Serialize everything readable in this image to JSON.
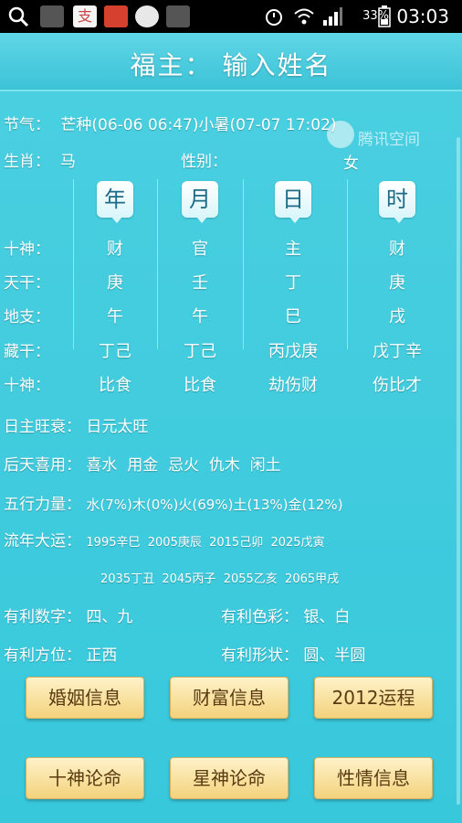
{
  "statusbar": {
    "battery_text": "33%",
    "time": "03:03",
    "icons": [
      "search-icon",
      "mail-app-icon",
      "alipay-icon",
      "app-icon",
      "weibo-icon",
      "mail-app-icon",
      "alarm-icon",
      "wifi-icon",
      "signal-icon",
      "battery-icon"
    ]
  },
  "title": "福主： 输入姓名",
  "watermark": "腾讯空间",
  "info": {
    "jieqi_label": "节气：",
    "jieqi_value": "芒种(06-06 06:47)小暑(07-07 17:02)",
    "shengxiao_label": "生肖：",
    "shengxiao_value": "马",
    "xingbie_label": "性别：",
    "xingbie_value": "女"
  },
  "columns": [
    "年",
    "月",
    "日",
    "时"
  ],
  "rows": [
    {
      "label": "十神：",
      "values": [
        "财",
        "官",
        "主",
        "财"
      ]
    },
    {
      "label": "天干：",
      "values": [
        "庚",
        "壬",
        "丁",
        "庚"
      ]
    },
    {
      "label": "地支：",
      "values": [
        "午",
        "午",
        "巳",
        "戌"
      ]
    },
    {
      "label": "藏干：",
      "values": [
        "丁己",
        "丁己",
        "丙戊庚",
        "戊丁辛"
      ]
    },
    {
      "label": "十神：",
      "values": [
        "比食",
        "比食",
        "劫伤财",
        "伤比才"
      ]
    }
  ],
  "details": {
    "rizhu_label": "日主旺衰：",
    "rizhu_value": "日元太旺",
    "xiyong_label": "后天喜用：",
    "xiyong_value": "喜水  用金  忌火  仇木  闲土",
    "wuxing_label": "五行力量：",
    "wuxing_value": "水(7%)木(0%)火(69%)土(13%)金(12%)",
    "liunian_label": "流年大运：",
    "liunian_line1": "1995辛巳  2005庚辰  2015己卯  2025戊寅",
    "liunian_line2": "2035丁丑  2045丙子  2055乙亥  2065甲戌",
    "shuzi_label": "有利数字：",
    "shuzi_value": "四、九",
    "secai_label": "有利色彩：",
    "secai_value": "银、白",
    "fangwei_label": "有利方位：",
    "fangwei_value": "正西",
    "xingzhuang_label": "有利形状：",
    "xingzhuang_value": "圆、半圆"
  },
  "buttons": [
    "婚姻信息",
    "财富信息",
    "2012运程",
    "十神论命",
    "星神论命",
    "性情信息"
  ]
}
